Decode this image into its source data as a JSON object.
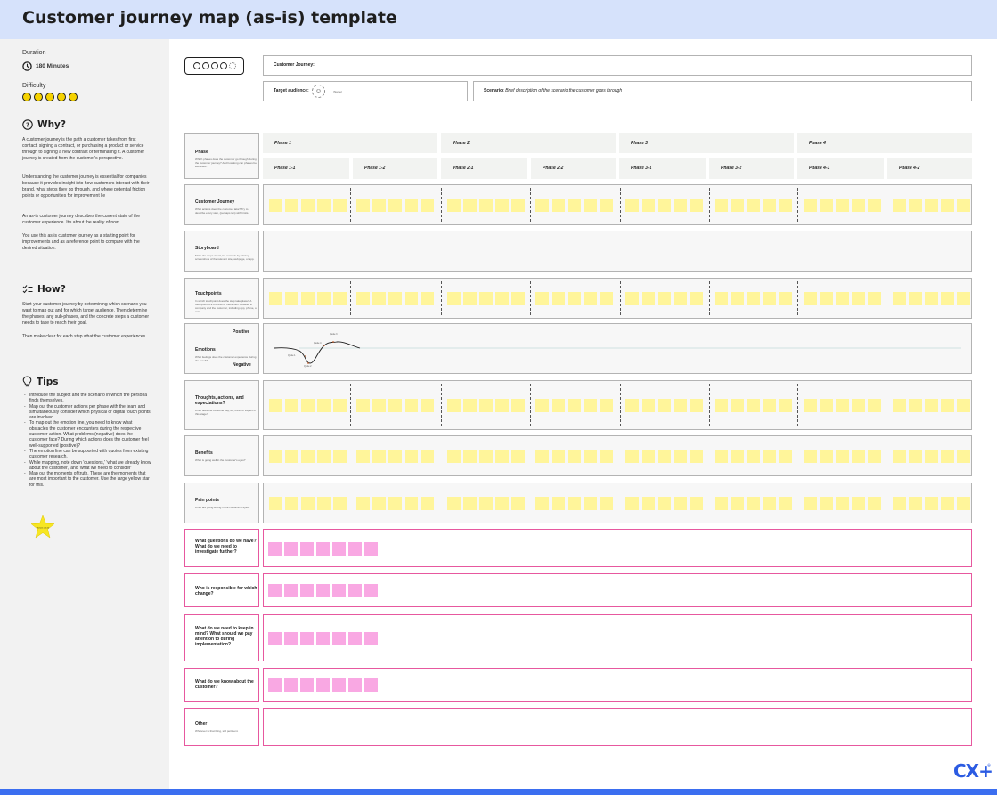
{
  "title": "Customer journey map (as-is) template",
  "sidebar": {
    "duration_label": "Duration",
    "duration_value": "180 Minutes",
    "difficulty_label": "Difficulty",
    "difficulty_level": 5,
    "difficulty_max": 5,
    "why_title": "Why?",
    "why_p1": "A customer journey is the path a customer takes from first contact, signing a contract, or purchasing a product or service through to signing a new contract or terminating it. A customer journey is created from the customer's perspective.",
    "why_p2": "Understanding the customer journey is essential for companies because it provides insight into how customers interact with their brand, what steps they go through, and where potential friction points or opportunities for improvement lie",
    "why_p3": "An as-is customer journey describes the current state of the customer experience. It's about the reality of now.",
    "why_p4": "You use this as-is customer journey as a starting point for improvements and as a reference point to compare with the desired situation.",
    "how_title": "How?",
    "how_p1": "Start your customer journey by determining which scenario you want to map out and for which target audience. Then determine the phases, any sub-phases, and the concrete steps a customer needs to take to reach their goal.",
    "how_p2": "Then make clear for each step what the customer experiences.",
    "tips_title": "Tips",
    "tips": [
      "Introduce the subject and the scenario in which the persona finds themselves.",
      "Map out the customer actions per phase with the team and simultaneously consider which physical or digital touch points are involved",
      "To map out the emotion line, you need to know what obstacles the customer encounters during the respective customer action. What problems (negative) does the customer face? During which actions does the customer feel well-supported (positive)?",
      "The emotion line can be supported with quotes from existing customer research.",
      "While mapping, note down 'questions,' 'what we already know about the customer,' and 'what we need to consider'",
      "Map out the moments of truth. These are the moments that are most important to the customer. Use the large yellow star for this."
    ],
    "star_label": "Moment of truth"
  },
  "top": {
    "journey_label": "Customer Journey:",
    "audience_label": "Target audience:",
    "audience_hint": "(Name)",
    "scenario_label": "Scenario:",
    "scenario_text": "Brief description of the scenario the customer goes through"
  },
  "phases": [
    "Phase 1",
    "Phase 2",
    "Phase 3",
    "Phase 4"
  ],
  "subphases": [
    "Phase 1-1",
    "Phase 1-2",
    "Phase 2-1",
    "Phase 2-2",
    "Phase 3-1",
    "Phase 3-2",
    "Phase 4-1",
    "Phase 4-2"
  ],
  "lanes": {
    "phase": {
      "title": "Phase",
      "desc": "Which phases does the customer go through during the customer journey? And how long can phases be identified?"
    },
    "journey": {
      "title": "Customer Journey",
      "desc": "What actions does the customer take? Try to describe every step, (perhaps ten) with limits."
    },
    "storyboard": {
      "title": "Storyboard",
      "desc": "Make the steps visual, for example by placing screenshots of the relevant site, webpage, or app."
    },
    "touchpoints": {
      "title": "Touchpoints",
      "desc": "In which touchpoint does the step take place? A touchpoint is a channel or interaction between a company and the customer, including app, phone, or mail."
    },
    "emotions": {
      "title": "Emotions",
      "desc": "What feelings does the customer experience during the result?",
      "positive": "Positive",
      "negative": "Negative"
    },
    "thoughts": {
      "title": "Thoughts, actions, and expectations?",
      "desc": "What does the customer say, do, think, or expect in this stage?"
    },
    "benefits": {
      "title": "Benefits",
      "desc": "What is going well in the customer's eyes?"
    },
    "pain": {
      "title": "Pain points",
      "desc": "What are going wrong in the customer's eyes?"
    },
    "questions": {
      "title": "What questions do we have? What do we need to investigate further?"
    },
    "responsible": {
      "title": "Who is responsible for which change?"
    },
    "keep_in_mind": {
      "title": "What do we need to keep in mind? What should we pay attention to during implementation?"
    },
    "know": {
      "title": "What do we know about the customer?"
    },
    "other": {
      "title": "Other",
      "desc": "Whatever is that thing, still pertinent."
    }
  },
  "emotion_notes": [
    "Quote 1",
    "Quote 2",
    "Quote 3",
    "Quote 4"
  ],
  "colors": {
    "header": "#d6e2fb",
    "accent": "#3b6ef0",
    "sticky_yellow": "#fff59a",
    "sticky_pink": "#f9a8e3",
    "pink_border": "#e7589f"
  },
  "logo": "CX+",
  "logo_mark": "®"
}
